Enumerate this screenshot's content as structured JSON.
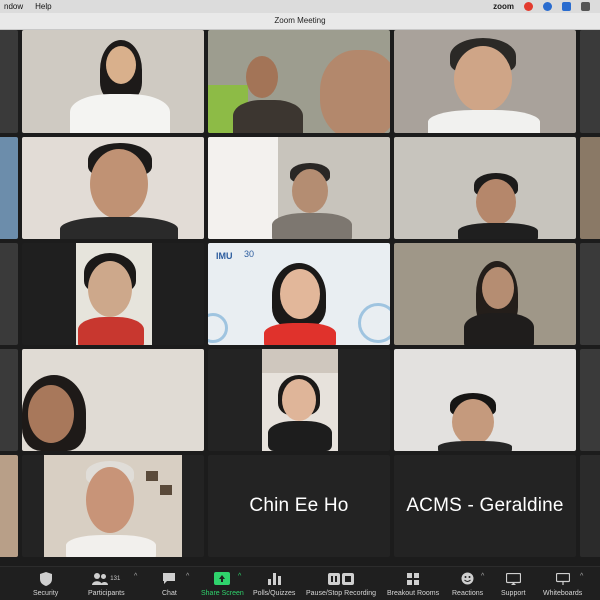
{
  "menubar": {
    "items": [
      "ndow",
      "Help"
    ],
    "app_logo": "zoom"
  },
  "window": {
    "title": "Zoom Meeting"
  },
  "tiles": [
    {
      "name": "Chin Ee Ho"
    },
    {
      "name": "ACMS - Geraldine"
    }
  ],
  "tile_logos": {
    "imu": "IMU",
    "anniversary": "30"
  },
  "toolbar": {
    "security": "Security",
    "participants": "Participants",
    "participant_count": "131",
    "chat": "Chat",
    "share_screen": "Share Screen",
    "polls": "Polls/Quizzes",
    "recording": "Pause/Stop Recording",
    "breakout": "Breakout Rooms",
    "reactions": "Reactions",
    "support": "Support",
    "whiteboards": "Whiteboards"
  },
  "colors": {
    "share_screen_accent": "#2fd36c",
    "toolbar_bg": "#1f1f1f",
    "grid_bg": "#1c1c1c"
  }
}
